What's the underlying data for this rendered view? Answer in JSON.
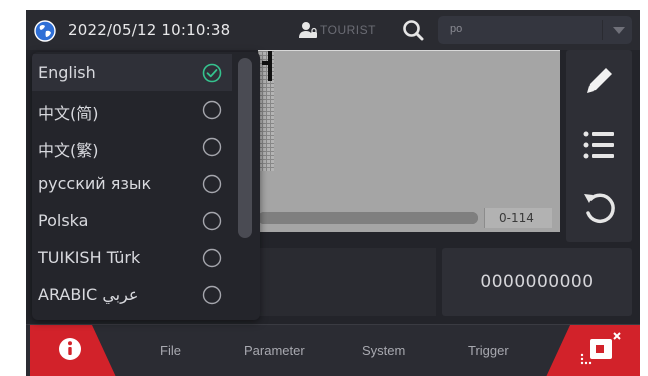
{
  "topbar": {
    "datetime": "2022/05/12 10:10:38",
    "user_label": "TOURIST",
    "search_value": "po",
    "globe_icon": "globe-icon",
    "user_icon": "user-lock-icon",
    "search_icon": "search-icon"
  },
  "preview": {
    "range_label": "0-114"
  },
  "tools": [
    {
      "icon": "pencil-icon"
    },
    {
      "icon": "list-icon"
    },
    {
      "icon": "undo-icon"
    }
  ],
  "counter": {
    "value": "0000000000"
  },
  "language_menu": {
    "items": [
      {
        "label": "English",
        "selected": true
      },
      {
        "label": "中文(简)",
        "selected": false
      },
      {
        "label": "中文(繁)",
        "selected": false
      },
      {
        "label": "русский язык",
        "selected": false
      },
      {
        "label": "Polska",
        "selected": false
      },
      {
        "label": "TUIKISH Türk",
        "selected": false
      },
      {
        "label": "ARABIC عربي",
        "selected": false
      }
    ]
  },
  "bottom_nav": {
    "info_icon": "info-icon",
    "items": [
      {
        "label": "File"
      },
      {
        "label": "Parameter"
      },
      {
        "label": "System"
      },
      {
        "label": "Trigger"
      }
    ],
    "alarm_icon": "printer-alarm-icon"
  },
  "colors": {
    "accent_red": "#d2222a",
    "check_green": "#35c28e",
    "background": "#23242a"
  }
}
